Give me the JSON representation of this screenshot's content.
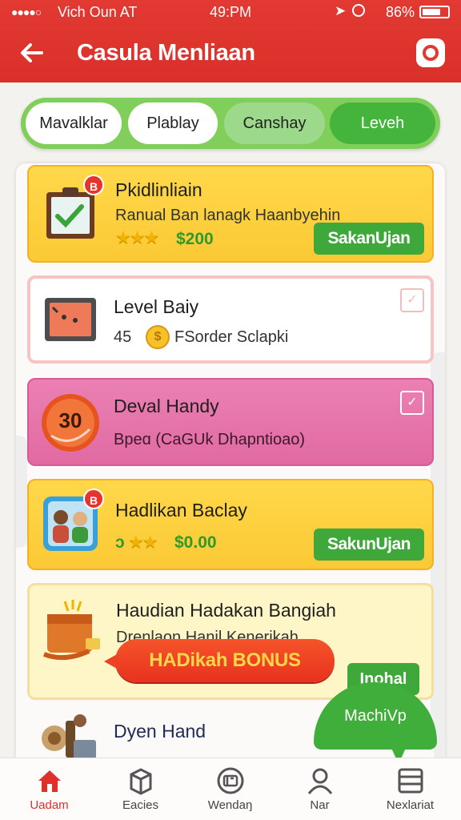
{
  "status_bar": {
    "signal": "●●●●○",
    "carrier": "Vich Oun  AT",
    "time": "49:PM",
    "battery_pct": "86%"
  },
  "header": {
    "title": "Casula Menliaan",
    "back_icon": "back-arrow-icon",
    "action_icon": "camera-icon",
    "color": "#e23a32"
  },
  "tabs": [
    {
      "label": "Mavalklar"
    },
    {
      "label": "Plablay"
    },
    {
      "label": "Canshay"
    },
    {
      "label": "Leveh",
      "active": true
    }
  ],
  "cards": [
    {
      "title": "Pkidlinliain",
      "desc": "Ranual Ban lanagk Haanbyehin",
      "stars": "★★★",
      "price": "$200",
      "badge": "B",
      "button": "SakanUjan"
    },
    {
      "title": "Level Baiy",
      "count": "45",
      "desc": "FSorder Sclapki"
    },
    {
      "title": "Deval Handy",
      "desc": "Bpeɑ (CaGUk Dhapntioao)",
      "icon_number": "30"
    },
    {
      "title": "Hadlikan Baclay",
      "stars": "★★",
      "star_prefix": "ɔ",
      "price": "$0.00",
      "badge": "B",
      "button": "SakunUjan"
    },
    {
      "title": "Haudian Hadakan Bangiah",
      "desc": "Drenlaon Hanil Kenerikah",
      "bonus": "HADikah BONUS",
      "button": "Inohal"
    },
    {
      "title": "Dyen Hand"
    }
  ],
  "floating_bubble": "MachiVp",
  "bottom_nav": [
    {
      "label": "Uadam",
      "icon": "home-icon",
      "active": true
    },
    {
      "label": "Eacies",
      "icon": "box-icon"
    },
    {
      "label": "Wendaŋ",
      "icon": "ticket-icon"
    },
    {
      "label": "Nar",
      "icon": "user-icon"
    },
    {
      "label": "Nexlariat",
      "icon": "menu-icon"
    }
  ]
}
